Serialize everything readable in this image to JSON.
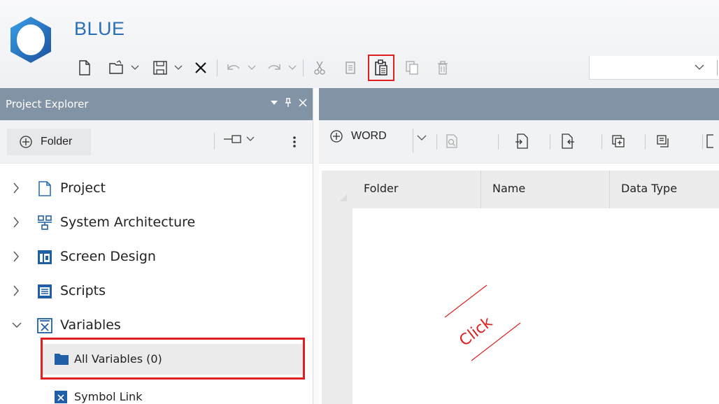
{
  "app": {
    "title": "BLUE",
    "accent": "#2a6fb5"
  },
  "toolbar": {
    "icons": [
      "new-file-icon",
      "open-folder-icon",
      "save-icon",
      "close-icon",
      "undo-icon",
      "redo-icon",
      "cut-icon",
      "copy-icon",
      "paste-icon",
      "duplicate-icon",
      "delete-icon"
    ],
    "highlighted": "paste-icon",
    "combo_value": ""
  },
  "project_explorer": {
    "title": "Project Explorer",
    "folder_button": "Folder",
    "tree": [
      {
        "label": "Project",
        "icon": "document-icon",
        "expanded": false
      },
      {
        "label": "System Architecture",
        "icon": "architecture-icon",
        "expanded": false
      },
      {
        "label": "Screen Design",
        "icon": "screen-design-icon",
        "expanded": false
      },
      {
        "label": "Scripts",
        "icon": "scripts-icon",
        "expanded": false
      },
      {
        "label": "Variables",
        "icon": "variables-icon",
        "expanded": true
      }
    ],
    "children": [
      {
        "label": "All Variables (0)",
        "icon": "folder-icon",
        "selected": true
      },
      {
        "label": "Symbol Link",
        "icon": "symbol-link-icon",
        "selected": false
      }
    ]
  },
  "main": {
    "toolbar": {
      "word_button": "WORD"
    },
    "grid": {
      "columns": [
        "Folder",
        "Name",
        "Data Type"
      ],
      "rows": []
    }
  },
  "annotation": {
    "text": "Click",
    "color": "#e02020"
  },
  "colors": {
    "panel_header": "#8393a6",
    "highlight": "#e02020",
    "selected_row": "#ebebeb"
  }
}
